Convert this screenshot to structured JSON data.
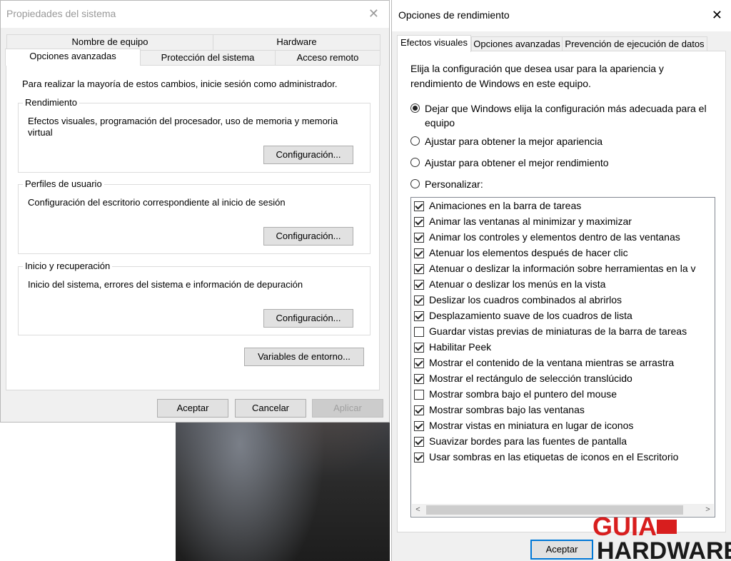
{
  "system_properties": {
    "title": "Propiedades del sistema",
    "close": "✕",
    "tabs_back": [
      "Nombre de equipo",
      "Hardware"
    ],
    "tabs_front": [
      "Opciones avanzadas",
      "Protección del sistema",
      "Acceso remoto"
    ],
    "intro": "Para realizar la mayoría de estos cambios, inicie sesión como administrador.",
    "groups": [
      {
        "title": "Rendimiento",
        "desc": "Efectos visuales, programación del procesador, uso de memoria y memoria virtual",
        "button": "Configuración..."
      },
      {
        "title": "Perfiles de usuario",
        "desc": "Configuración del escritorio correspondiente al inicio de sesión",
        "button": "Configuración..."
      },
      {
        "title": "Inicio y recuperación",
        "desc": "Inicio del sistema, errores del sistema e información de depuración",
        "button": "Configuración..."
      }
    ],
    "env_button": "Variables de entorno...",
    "footer": {
      "accept": "Aceptar",
      "cancel": "Cancelar",
      "apply": "Aplicar"
    }
  },
  "performance_options": {
    "title": "Opciones de rendimiento",
    "close": "✕",
    "tabs": [
      "Efectos visuales",
      "Opciones avanzadas",
      "Prevención de ejecución de datos"
    ],
    "intro": "Elija la configuración que desea usar para la apariencia y rendimiento de Windows en este equipo.",
    "radios": [
      {
        "label": "Dejar que Windows elija la configuración más adecuada para el equipo",
        "checked": true
      },
      {
        "label": "Ajustar para obtener la mejor apariencia",
        "checked": false
      },
      {
        "label": "Ajustar para obtener el mejor rendimiento",
        "checked": false
      },
      {
        "label": "Personalizar:",
        "checked": false
      }
    ],
    "effects": [
      {
        "label": "Animaciones en la barra de tareas",
        "checked": true
      },
      {
        "label": "Animar las ventanas al minimizar y maximizar",
        "checked": true
      },
      {
        "label": "Animar los controles y elementos dentro de las ventanas",
        "checked": true
      },
      {
        "label": "Atenuar los elementos después de hacer clic",
        "checked": true
      },
      {
        "label": "Atenuar o deslizar la información sobre herramientas en la v",
        "checked": true
      },
      {
        "label": "Atenuar o deslizar los menús en la vista",
        "checked": true
      },
      {
        "label": "Deslizar los cuadros combinados al abrirlos",
        "checked": true
      },
      {
        "label": "Desplazamiento suave de los cuadros de lista",
        "checked": true
      },
      {
        "label": "Guardar vistas previas de miniaturas de la barra de tareas",
        "checked": false
      },
      {
        "label": "Habilitar Peek",
        "checked": true
      },
      {
        "label": "Mostrar el contenido de la ventana mientras se arrastra",
        "checked": true
      },
      {
        "label": "Mostrar el rectángulo de selección translúcido",
        "checked": true
      },
      {
        "label": "Mostrar sombra bajo el puntero del mouse",
        "checked": false
      },
      {
        "label": "Mostrar sombras bajo las ventanas",
        "checked": true
      },
      {
        "label": "Mostrar vistas en miniatura en lugar de iconos",
        "checked": true
      },
      {
        "label": "Suavizar bordes para las fuentes de pantalla",
        "checked": true
      },
      {
        "label": "Usar sombras en las etiquetas de iconos en el Escritorio",
        "checked": true
      }
    ],
    "scroll_left": "<",
    "scroll_right": ">",
    "accept": "Aceptar"
  },
  "watermark": {
    "line1": "GUIA",
    "line2": "HARDWARE"
  }
}
